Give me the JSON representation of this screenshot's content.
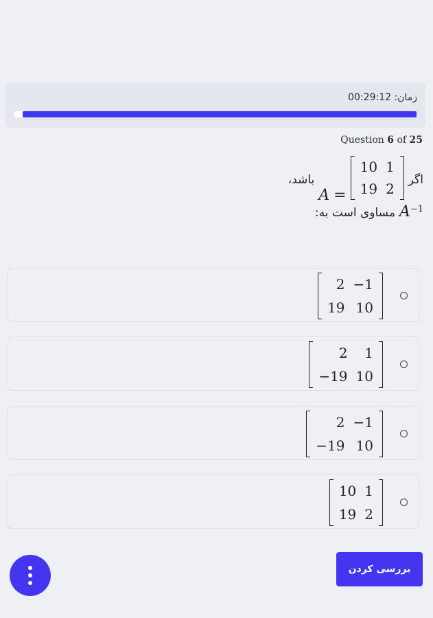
{
  "timer": {
    "label": "زمان:",
    "value": "00:29:12",
    "progress": 0.98
  },
  "question": {
    "counter_prefix": "Question",
    "number": "6",
    "counter_of": "of",
    "total": "25",
    "text_if": "اگر",
    "text_then": "باشد،",
    "variable": "A",
    "equals": "=",
    "matrix": [
      [
        "10",
        "1"
      ],
      [
        "19",
        "2"
      ]
    ],
    "inverse_base": "A",
    "inverse_exp": "−1",
    "text_equals_to": "مساوی است به:"
  },
  "options": [
    {
      "matrix": [
        [
          "2",
          "−1"
        ],
        [
          "19",
          "10"
        ]
      ]
    },
    {
      "matrix": [
        [
          "2",
          "1"
        ],
        [
          "−19",
          "10"
        ]
      ]
    },
    {
      "matrix": [
        [
          "2",
          "−1"
        ],
        [
          "−19",
          "10"
        ]
      ]
    },
    {
      "matrix": [
        [
          "10",
          "1"
        ],
        [
          "19",
          "2"
        ]
      ]
    }
  ],
  "actions": {
    "review_label": "بررسی کردن",
    "menu_icon": "more-vertical-icon"
  },
  "colors": {
    "accent": "#4436f0",
    "background": "#eef0f4",
    "timer_card": "#e4e7ee"
  }
}
